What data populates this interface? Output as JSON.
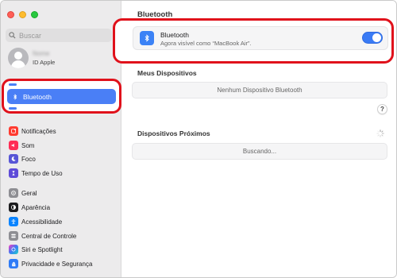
{
  "window": {
    "title": "Bluetooth"
  },
  "sidebar": {
    "search": {
      "placeholder": "Buscar"
    },
    "account": {
      "name": "Nome",
      "subtitle": "ID Apple"
    },
    "selected": {
      "label": "Bluetooth",
      "icon": "bluetooth-icon"
    },
    "items": [
      {
        "label": "Notificações",
        "icon": "notifications-icon",
        "color": "#ff3b30"
      },
      {
        "label": "Som",
        "icon": "sound-icon",
        "color": "#ff2d55"
      },
      {
        "label": "Foco",
        "icon": "focus-icon",
        "color": "#5856d6"
      },
      {
        "label": "Tempo de Uso",
        "icon": "screen-time-icon",
        "color": "#5e4bd8"
      },
      {
        "label": "Geral",
        "icon": "general-icon",
        "color": "#8e8e93"
      },
      {
        "label": "Aparência",
        "icon": "appearance-icon",
        "color": "#1c1c1e"
      },
      {
        "label": "Acessibilidade",
        "icon": "accessibility-icon",
        "color": "#0a84ff"
      },
      {
        "label": "Central de Controle",
        "icon": "control-center-icon",
        "color": "#8e8e93"
      },
      {
        "label": "Siri e Spotlight",
        "icon": "siri-icon",
        "color": "#6a5acd"
      },
      {
        "label": "Privacidade e Segurança",
        "icon": "privacy-hand-icon",
        "color": "#2f7bf6"
      }
    ]
  },
  "main": {
    "title": "Bluetooth",
    "bluetooth_card": {
      "name": "Bluetooth",
      "status": "Agora visível como “MacBook Air”.",
      "enabled": true,
      "accent": "#3a7bf5"
    },
    "my_devices": {
      "title": "Meus Dispositivos",
      "empty_text": "Nenhum Dispositivo Bluetooth"
    },
    "help_label": "?",
    "nearby": {
      "title": "Dispositivos Próximos",
      "status_text": "Buscando..."
    }
  },
  "colors": {
    "highlight_frame": "#e0111b",
    "selection": "#4a7ff6"
  }
}
